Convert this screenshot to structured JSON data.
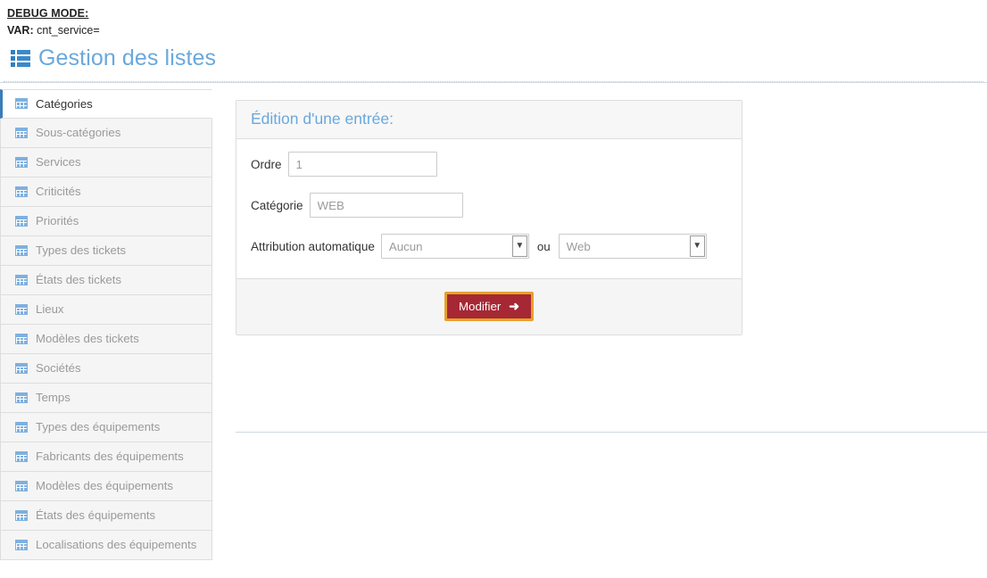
{
  "debug": {
    "mode_label": "DEBUG MODE:",
    "var_label": "VAR:",
    "var_value": "cnt_service="
  },
  "header": {
    "title": "Gestion des listes",
    "icon": "th-list-icon",
    "title_color": "#6aa8dd"
  },
  "sidebar": {
    "items": [
      {
        "label": "Catégories",
        "icon": "table-icon",
        "active": true
      },
      {
        "label": "Sous-catégories",
        "icon": "table-icon",
        "active": false
      },
      {
        "label": "Services",
        "icon": "table-icon",
        "active": false
      },
      {
        "label": "Criticités",
        "icon": "table-icon",
        "active": false
      },
      {
        "label": "Priorités",
        "icon": "table-icon",
        "active": false
      },
      {
        "label": "Types des tickets",
        "icon": "table-icon",
        "active": false
      },
      {
        "label": "États des tickets",
        "icon": "table-icon",
        "active": false
      },
      {
        "label": "Lieux",
        "icon": "table-icon",
        "active": false
      },
      {
        "label": "Modèles des tickets",
        "icon": "table-icon",
        "active": false
      },
      {
        "label": "Sociétés",
        "icon": "table-icon",
        "active": false
      },
      {
        "label": "Temps",
        "icon": "table-icon",
        "active": false
      },
      {
        "label": "Types des équipements",
        "icon": "table-icon",
        "active": false
      },
      {
        "label": "Fabricants des équipements",
        "icon": "table-icon",
        "active": false
      },
      {
        "label": "Modèles des équipements",
        "icon": "table-icon",
        "active": false
      },
      {
        "label": "États des équipements",
        "icon": "table-icon",
        "active": false
      },
      {
        "label": "Localisations des équipements",
        "icon": "table-icon",
        "active": false
      }
    ]
  },
  "panel": {
    "title": "Édition d'une entrée:",
    "fields": {
      "ordre": {
        "label": "Ordre",
        "value": "1"
      },
      "categorie": {
        "label": "Catégorie",
        "value": "WEB"
      },
      "attribution": {
        "label": "Attribution automatique",
        "select_one": "Aucun",
        "separator": "ou",
        "select_two": "Web",
        "chevron": "chevron-down-icon"
      }
    },
    "footer": {
      "submit_label": "Modifier",
      "submit_arrow": "➜",
      "submit_bg": "#a52834",
      "submit_border": "#e8a02c"
    }
  }
}
